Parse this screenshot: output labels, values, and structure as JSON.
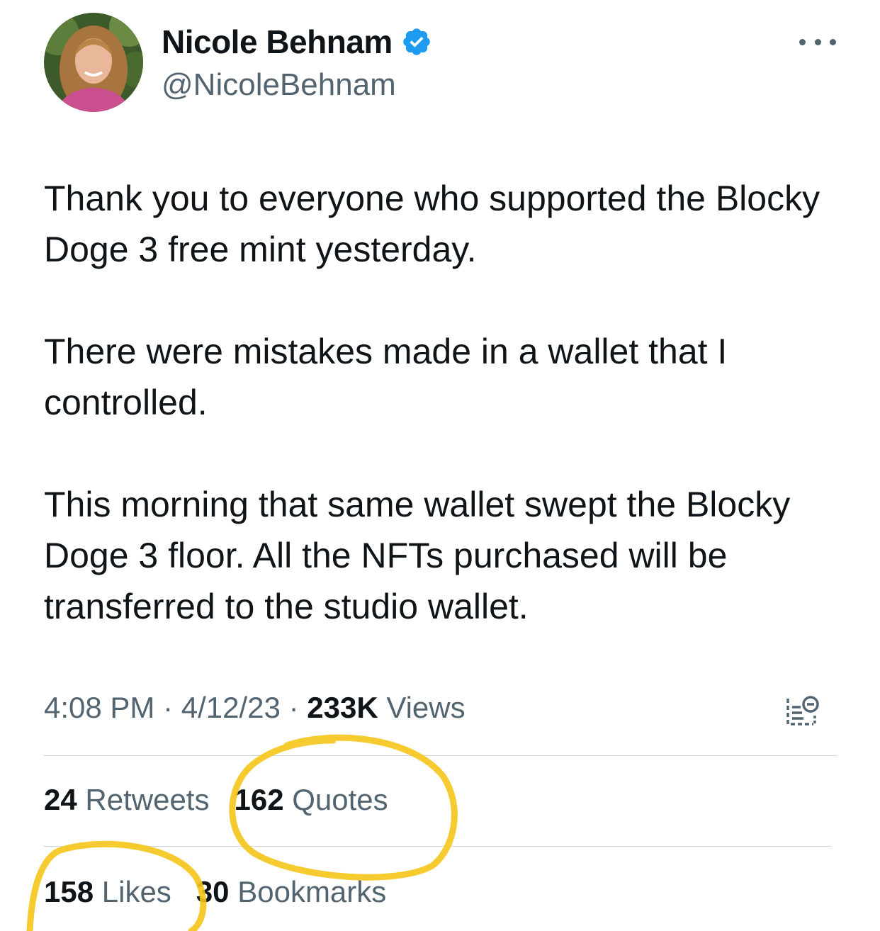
{
  "author": {
    "display_name": "Nicole Behnam",
    "handle": "@NicoleBehnam",
    "verified": true
  },
  "tweet": {
    "paragraphs": [
      "Thank you to everyone who supported the Blocky Doge 3 free mint yesterday.",
      "There were mistakes made in a wallet that I controlled.",
      "This morning that same wallet swept the Blocky Doge 3 floor. All the NFTs purchased will be transferred to the studio wallet."
    ],
    "time": "4:08 PM",
    "date": "4/12/23",
    "views_count": "233K",
    "views_label": "Views",
    "separator": "·"
  },
  "stats": {
    "retweets": {
      "count": "24",
      "label": "Retweets"
    },
    "quotes": {
      "count": "162",
      "label": "Quotes"
    },
    "likes": {
      "count": "158",
      "label": "Likes"
    },
    "bookmarks": {
      "count": "30",
      "label": "Bookmarks"
    }
  },
  "icons": {
    "verified": "verified-badge-icon",
    "more": "more-options-icon",
    "analytics": "view-analytics-icon"
  },
  "colors": {
    "text_primary": "#0f1419",
    "text_secondary": "#536471",
    "verified_blue": "#1d9bf0",
    "divider": "#cfd9de",
    "highlight_marker": "#f5c518"
  }
}
